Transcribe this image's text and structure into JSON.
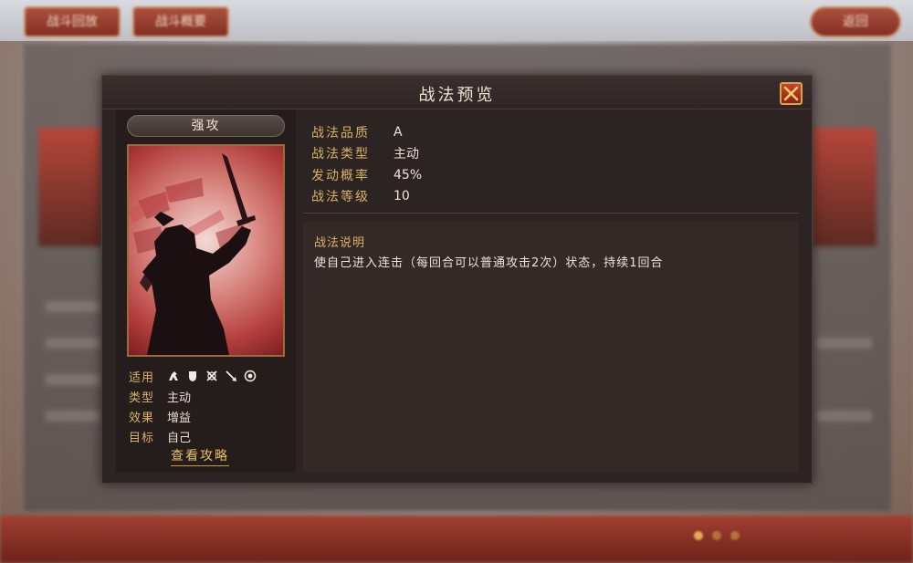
{
  "background": {
    "top_left_buttons": [
      "战斗回放",
      "战斗概要"
    ],
    "back_button": "返回"
  },
  "modal": {
    "title": "战法预览",
    "close_icon": "close-x-icon"
  },
  "skill": {
    "name": "强攻",
    "attributes": [
      {
        "key": "适用",
        "icons": [
          "cavalry-icon",
          "shield-icon",
          "crossed-weapons-icon",
          "spear-icon",
          "target-icon"
        ]
      },
      {
        "key": "类型",
        "value": "主动"
      },
      {
        "key": "效果",
        "value": "增益"
      },
      {
        "key": "目标",
        "value": "自己"
      }
    ],
    "guide_link": "查看攻略",
    "info": [
      {
        "key": "战法品质",
        "value": "A"
      },
      {
        "key": "战法类型",
        "value": "主动"
      },
      {
        "key": "发动概率",
        "value": "45%"
      },
      {
        "key": "战法等级",
        "value": "10"
      }
    ],
    "description_title": "战法说明",
    "description": "使自己进入连击（每回合可以普通攻击2次）状态，持续1回合"
  },
  "colors": {
    "accent_gold": "#d9b266",
    "modal_bg": "#2b2422",
    "close_red": "#c8452f"
  }
}
